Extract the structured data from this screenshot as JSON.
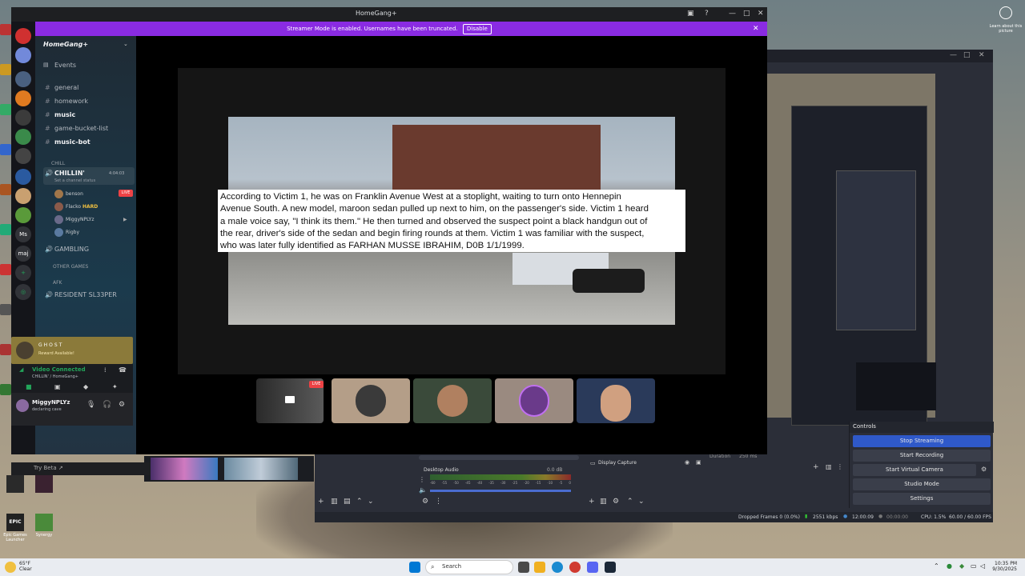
{
  "discord": {
    "window_title": "HomeGang+",
    "banner_text": "Streamer Mode is enabled. Usernames have been truncated.",
    "banner_button": "Disable",
    "server_name": "HomeGang+",
    "events_label": "Events",
    "channels": [
      {
        "name": "general"
      },
      {
        "name": "homework"
      },
      {
        "name": "music"
      },
      {
        "name": "game-bucket-list"
      },
      {
        "name": "music-bot"
      }
    ],
    "categories": {
      "chill": "CHILL",
      "other_games": "OTHER GAMES",
      "afk": "AFK"
    },
    "voice_channel": {
      "name": "CHILLIN'",
      "timer": "4:04:03",
      "status_hint": "Set a channel status"
    },
    "voice_users": [
      {
        "name": "benson",
        "badge": "LIVE"
      },
      {
        "name": "Flacko",
        "badge": "HARD"
      },
      {
        "name": "MiggyNPLYz",
        "badge": ""
      },
      {
        "name": "Rigby",
        "badge": ""
      }
    ],
    "gambling_channel": "GAMBLING",
    "resident_channel": "RESIDENT SL33PER",
    "reward": {
      "title": "GHOST",
      "subtitle": "Reward Available!"
    },
    "voice_status": {
      "title": "Video Connected",
      "subtitle": "CHILLIN' / HomeGang+"
    },
    "user": {
      "name": "MiggyNPLYz",
      "status": "declaring cave"
    },
    "try_beta": "Try Beta ↗",
    "caption": "According to Victim 1, he was on Franklin Avenue West at a stoplight, waiting to turn onto Hennepin\nAvenue South. A new model, maroon sedan pulled up next to him, on the passenger's side. Victim 1 heard\na male voice say, \"I think its them.\" He then turned and observed the suspect point a black handgun out of\nthe rear, driver's side of the sedan and begin firing rounds at them. Victim 1 was familiar with the suspect,\nwho was later fully identified as FARHAN MUSSE IBRAHIM, D0B 1/1/1999.",
    "tile_live": "LIVE"
  },
  "obs": {
    "controls_title": "Controls",
    "buttons": [
      "Stop Streaming",
      "Start Recording",
      "Start Virtual Camera",
      "Studio Mode",
      "Settings"
    ],
    "audio_label": "Desktop Audio",
    "audio_db": "0.0 dB",
    "audio_scale": [
      "-60",
      "-55",
      "-50",
      "-45",
      "-40",
      "-35",
      "-30",
      "-25",
      "-20",
      "-15",
      "-10",
      "-5",
      "0"
    ],
    "source_label": "Display Capture",
    "duration_label": "Duration",
    "duration_value": "250 ms",
    "status": {
      "dropped": "Dropped Frames 0 (0.0%)",
      "bitrate": "2551 kbps",
      "live_time": "12:00:09",
      "rec_time": "00:00:00",
      "cpu": "CPU: 1.5%",
      "fps": "60.00 / 60.00 FPS"
    }
  },
  "taskbar": {
    "weather_temp": "65°F",
    "weather_cond": "Clear",
    "search": "Search",
    "time": "10:35 PM",
    "date": "9/30/2025"
  },
  "learn_about": "Learn about this picture",
  "desktop_icons": [
    "Epic Games Launcher",
    "Synergy"
  ]
}
